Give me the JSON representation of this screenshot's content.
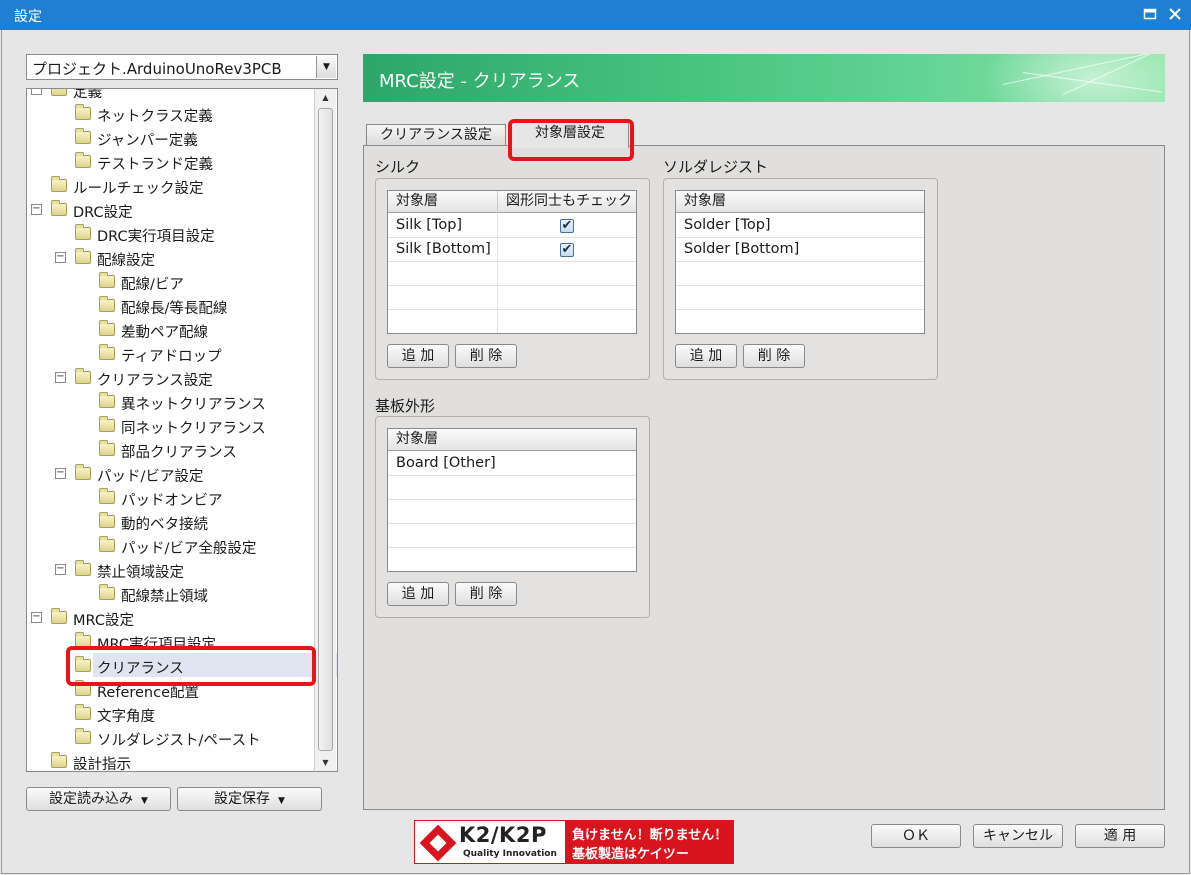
{
  "window": {
    "title": "設定",
    "maximize_icon": "maximize-icon",
    "close_icon": "close-icon"
  },
  "project_select": {
    "value": "プロジェクト.ArduinoUnoRev3PCB"
  },
  "tree": {
    "items": [
      {
        "label": "定義"
      },
      {
        "label": "ネットクラス定義"
      },
      {
        "label": "ジャンパー定義"
      },
      {
        "label": "テストランド定義"
      },
      {
        "label": "ルールチェック設定"
      },
      {
        "label": "DRC設定"
      },
      {
        "label": "DRC実行項目設定"
      },
      {
        "label": "配線設定"
      },
      {
        "label": "配線/ビア"
      },
      {
        "label": "配線長/等長配線"
      },
      {
        "label": "差動ペア配線"
      },
      {
        "label": "ティアドロップ"
      },
      {
        "label": "クリアランス設定"
      },
      {
        "label": "異ネットクリアランス"
      },
      {
        "label": "同ネットクリアランス"
      },
      {
        "label": "部品クリアランス"
      },
      {
        "label": "パッド/ビア設定"
      },
      {
        "label": "パッドオンビア"
      },
      {
        "label": "動的ベタ接続"
      },
      {
        "label": "パッド/ビア全般設定"
      },
      {
        "label": "禁止領域設定"
      },
      {
        "label": "配線禁止領域"
      },
      {
        "label": "MRC設定"
      },
      {
        "label": "MRC実行項目設定"
      },
      {
        "label": "クリアランス"
      },
      {
        "label": "Reference配置"
      },
      {
        "label": "文字角度"
      },
      {
        "label": "ソルダレジスト/ペースト"
      },
      {
        "label": "設計指示"
      }
    ]
  },
  "left_buttons": {
    "load": "設定読み込み",
    "save": "設定保存"
  },
  "banner": {
    "title": "MRC設定 - クリアランス"
  },
  "tabs": [
    {
      "label": "クリアランス設定"
    },
    {
      "label": "対象層設定"
    }
  ],
  "groups": {
    "silk": {
      "label": "シルク",
      "headers": [
        "対象層",
        "図形同士もチェック"
      ],
      "rows": [
        {
          "layer": "Silk [Top]",
          "checked": true
        },
        {
          "layer": "Silk [Bottom]",
          "checked": true
        }
      ],
      "add": "追 加",
      "delete": "削 除"
    },
    "solder": {
      "label": "ソルダレジスト",
      "headers": [
        "対象層"
      ],
      "rows": [
        {
          "layer": "Solder [Top]"
        },
        {
          "layer": "Solder [Bottom]"
        }
      ],
      "add": "追 加",
      "delete": "削 除"
    },
    "board": {
      "label": "基板外形",
      "headers": [
        "対象層"
      ],
      "rows": [
        {
          "layer": "Board [Other]"
        }
      ],
      "add": "追 加",
      "delete": "削 除"
    }
  },
  "check_glyph": "✔",
  "ad": {
    "brand": "K2/K2P",
    "tagline": "Quality Innovation",
    "slogan1": "負けません！断りません！",
    "slogan2": "基板製造はケイツー"
  },
  "dialog_buttons": {
    "ok": "ＯＫ",
    "cancel": "キャンセル",
    "apply": "適 用"
  },
  "colors": {
    "titlebar": "#1e7fd3",
    "highlight": "#e8131b",
    "banner": "#47c37e",
    "ad": "#d8151f"
  }
}
